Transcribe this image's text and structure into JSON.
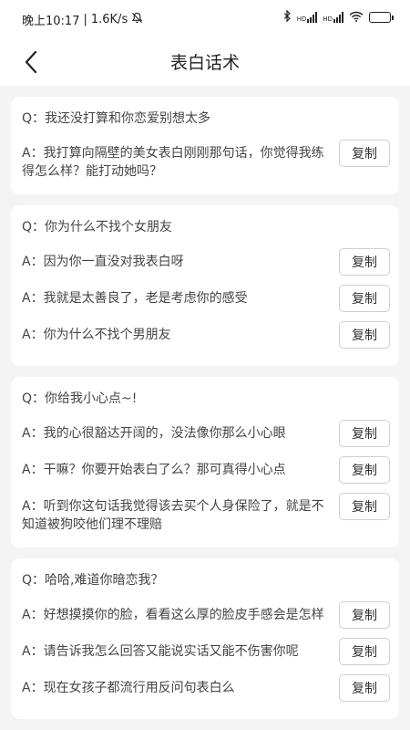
{
  "status": {
    "time": "晚上10:17",
    "separator": "|",
    "speed": "1.6K/s",
    "network1": "HD",
    "network2": "HD"
  },
  "header": {
    "title": "表白话术"
  },
  "copy_label": "复制",
  "cards": [
    {
      "question": "Q：我还没打算和你恋爱别想太多",
      "answers": [
        "A：我打算向隔壁的美女表白刚刚那句话，你觉得我练得怎么样？能打动她吗？"
      ]
    },
    {
      "question": "Q：你为什么不找个女朋友",
      "answers": [
        "A：因为你一直没对我表白呀",
        "A：我就是太善良了，老是考虑你的感受",
        "A：你为什么不找个男朋友"
      ]
    },
    {
      "question": "Q：你给我小心点~!",
      "answers": [
        "A：我的心很豁达开阔的，没法像你那么小心眼",
        "A：干嘛？你要开始表白了么？那可真得小心点",
        "A：听到你这句话我觉得该去买个人身保险了，就是不知道被狗咬他们理不理赔"
      ]
    },
    {
      "question": "Q：哈哈,难道你暗恋我？",
      "answers": [
        "A：好想摸摸你的脸，看看这么厚的脸皮手感会是怎样",
        "A：请告诉我怎么回答又能说实话又能不伤害你呢",
        "A：现在女孩子都流行用反问句表白么"
      ]
    }
  ]
}
